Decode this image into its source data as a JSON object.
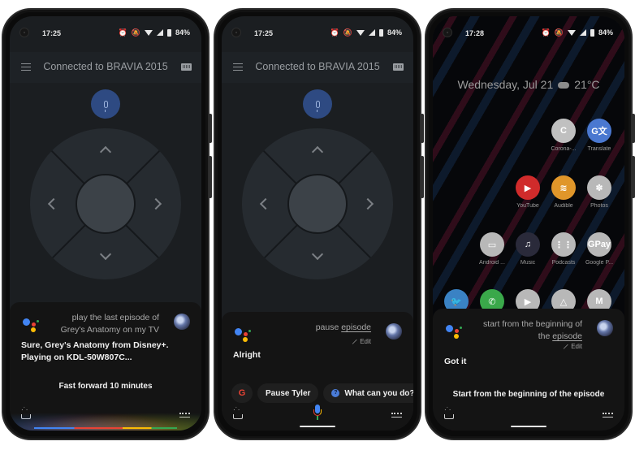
{
  "phones": [
    {
      "status": {
        "time": "17:25",
        "battery": "84%"
      },
      "app": {
        "title": "Connected to BRAVIA 2015"
      },
      "assistant": {
        "query_lines": [
          "play the last episode of",
          "Grey's Anatomy on my TV"
        ],
        "reply_lines": [
          "Sure, Grey's Anatomy from Disney+.",
          "Playing on KDL-50W807C..."
        ],
        "suggestion": "Fast forward 10 minutes"
      }
    },
    {
      "status": {
        "time": "17:25",
        "battery": "84%"
      },
      "app": {
        "title": "Connected to BRAVIA 2015"
      },
      "assistant": {
        "query_prefix": "pause ",
        "query_underlined": "episode",
        "edit_label": "Edit",
        "reply": "Alright",
        "chips": {
          "google": "G",
          "pause": "Pause Tyler",
          "help": "What can you do?",
          "help_icon": "?"
        }
      }
    },
    {
      "status": {
        "time": "17:28",
        "battery": "84%"
      },
      "home": {
        "date": "Wednesday, Jul 21",
        "temperature": "21°C",
        "apps": [
          {
            "label": "Corona-...",
            "color": "#c0c0c0",
            "glyph": "C"
          },
          {
            "label": "Translate",
            "color": "#4a78d0",
            "glyph": "G文"
          },
          {
            "label": "YouTube",
            "color": "#d02b2b",
            "glyph": "▶"
          },
          {
            "label": "Audible",
            "color": "#e0962a",
            "glyph": "≋"
          },
          {
            "label": "Photos",
            "color": "#b8b8b8",
            "glyph": "✽"
          },
          {
            "label": "Android ...",
            "color": "#b8b8b8",
            "glyph": "▭"
          },
          {
            "label": "Music",
            "color": "#2a2a3a",
            "glyph": "♫"
          },
          {
            "label": "Podcasts",
            "color": "#b8b8b8",
            "glyph": "⋮⋮"
          },
          {
            "label": "Google P...",
            "color": "#b8b8b8",
            "glyph": "GPay"
          },
          {
            "label": "",
            "color": "#3a82c4",
            "glyph": "🐦"
          },
          {
            "label": "",
            "color": "#3aa84a",
            "glyph": "✆"
          },
          {
            "label": "",
            "color": "#b8b8b8",
            "glyph": "▶"
          },
          {
            "label": "",
            "color": "#b8b8b8",
            "glyph": "△"
          },
          {
            "label": "",
            "color": "#b8b8b8",
            "glyph": "M"
          }
        ]
      },
      "assistant": {
        "query_lines_prefix": "start from the beginning of",
        "query_line2_prefix": "the ",
        "query_underlined": "episode",
        "edit_label": "Edit",
        "reply": "Got it",
        "suggestion": "Start from the beginning of the episode"
      }
    }
  ]
}
